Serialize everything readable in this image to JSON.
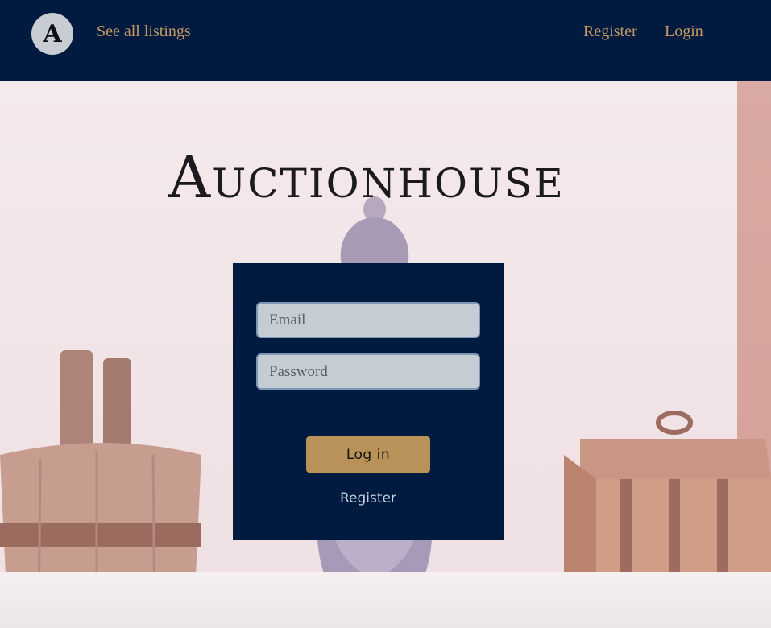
{
  "header": {
    "logo_letter": "A",
    "see_all_label": "See all listings",
    "register_label": "Register",
    "login_label": "Login"
  },
  "hero": {
    "title": "Auctionhouse"
  },
  "login_form": {
    "email_placeholder": "Email",
    "password_placeholder": "Password",
    "submit_label": "Log in",
    "register_link": "Register"
  },
  "colors": {
    "navy": "#001a40",
    "accent_gold": "#b89258",
    "nav_link": "#c49a62",
    "input_bg": "#c5ccd3"
  }
}
